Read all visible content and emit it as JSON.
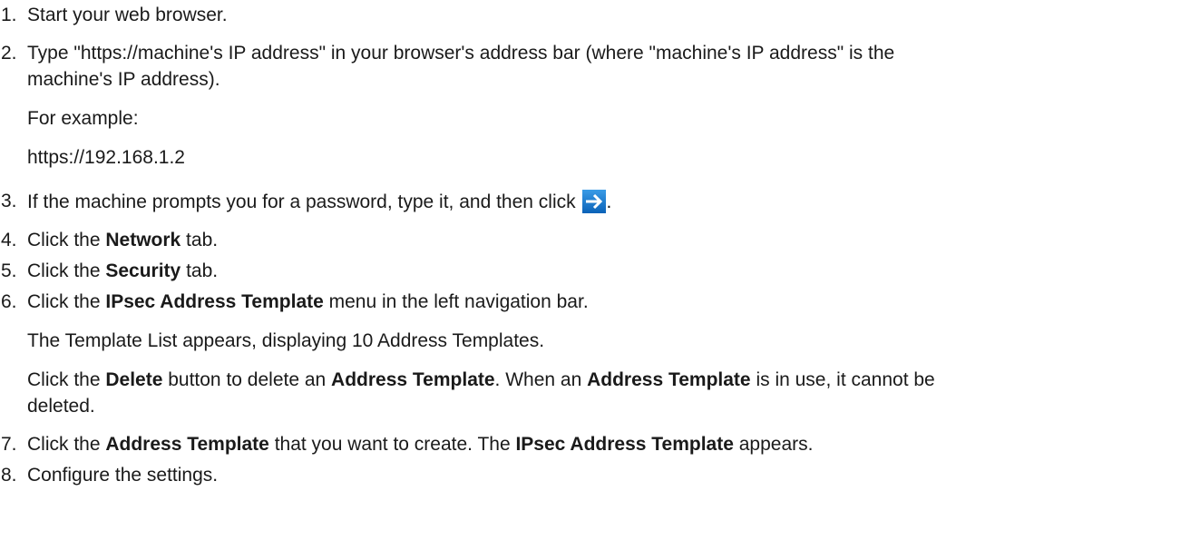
{
  "steps": [
    {
      "num": "1.",
      "text": "Start your web browser."
    },
    {
      "num": "2.",
      "line1": "Type \"https://machine's IP address\" in your browser's address bar (where \"machine's IP address\" is the",
      "line2": "machine's IP address).",
      "example_label": "For example:",
      "example_value": "https://192.168.1.2"
    },
    {
      "num": "3.",
      "text": "If the machine prompts you for a password, type it, and then click",
      "suffix": "."
    },
    {
      "num": "4.",
      "pre": "Click the ",
      "bold": "Network",
      "post": " tab."
    },
    {
      "num": "5.",
      "pre": "Click the ",
      "bold": "Security",
      "post": " tab."
    },
    {
      "num": "6.",
      "pre": "Click the ",
      "bold": "IPsec Address Template",
      "post": " menu in the left navigation bar.",
      "note": "The Template List appears, displaying 10 Address Templates.",
      "del_pre": "Click the ",
      "del_bold1": "Delete",
      "del_mid1": " button to delete an ",
      "del_bold2": "Address Template",
      "del_mid2": ". When an ",
      "del_bold3": "Address Template",
      "del_post": " is in use, it cannot be",
      "del_line2": "deleted."
    },
    {
      "num": "7.",
      "pre": "Click the ",
      "bold1": "Address Template",
      "mid": " that you want to create. The ",
      "bold2": "IPsec Address Template",
      "post": " appears."
    },
    {
      "num": "8.",
      "text": "Configure the settings."
    }
  ],
  "icons": {
    "go": "arrow-right-icon",
    "go_color": "#1a7fd6"
  }
}
